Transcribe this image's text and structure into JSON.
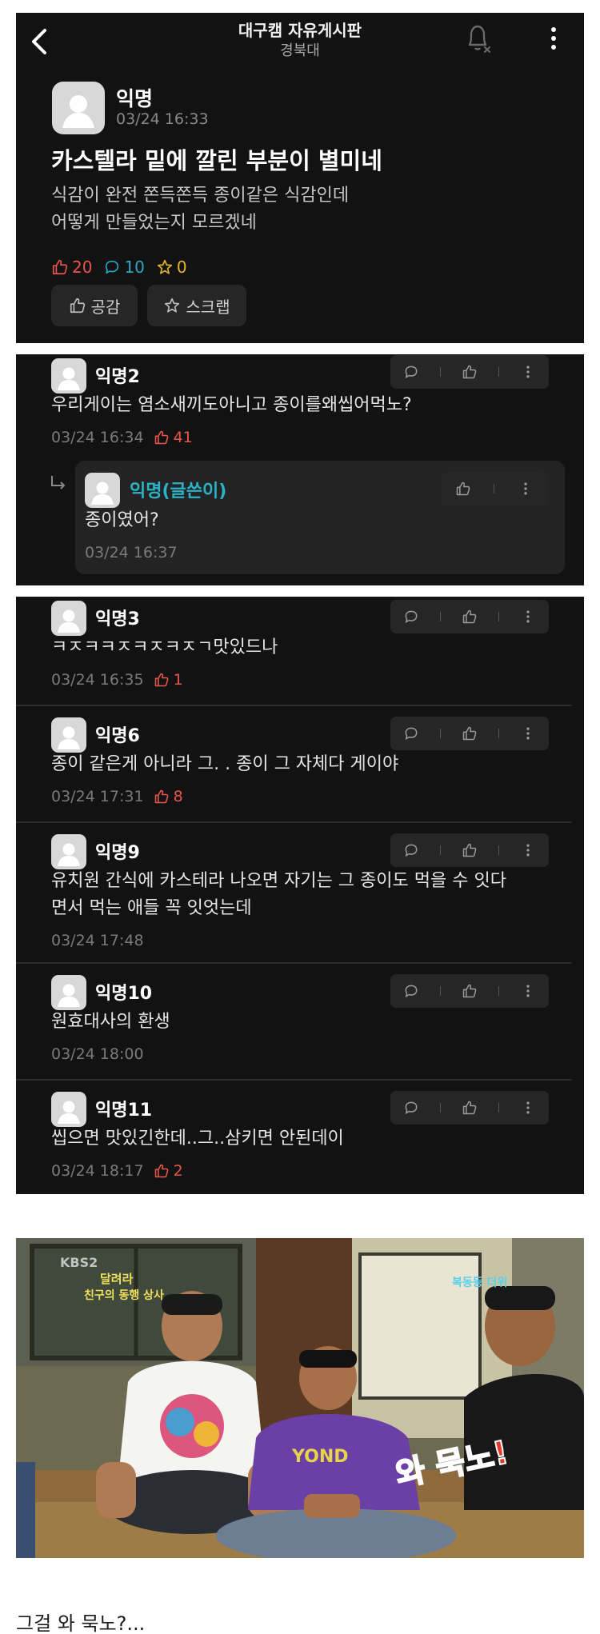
{
  "header": {
    "title": "대구캠 자유게시판",
    "subtitle": "경북대"
  },
  "post": {
    "author": "익명",
    "time": "03/24 16:33",
    "title": "카스텔라 밑에 깔린 부분이 별미네",
    "body": [
      "식감이 완전 쫀득쫀득 종이같은 식감인데",
      "어떻게 만들었는지 모르겠네"
    ],
    "likes": "20",
    "comments": "10",
    "scraps": "0",
    "like_button": "공감",
    "scrap_button": "스크랩"
  },
  "comments_a": [
    {
      "author": "익명2",
      "text": "우리게이는 염소새끼도아니고 종이를왜씹어먹노?",
      "time": "03/24 16:34",
      "likes": "41"
    }
  ],
  "reply": {
    "author": "익명(글쓴이)",
    "text": "종이였어?",
    "time": "03/24 16:37"
  },
  "comments_b": [
    {
      "author": "익명3",
      "text": [
        "ㅋㅈㅋㅋㅈㅋㅈㅋㅈㄱ맛있드나"
      ],
      "time": "03/24 16:35",
      "likes": "1"
    },
    {
      "author": "익명6",
      "text": [
        "종이 같은게 아니라 그. .  종이 그 자체다 게이야"
      ],
      "time": "03/24 17:31",
      "likes": "8"
    },
    {
      "author": "익명9",
      "text": [
        "유치원 간식에 카스테라 나오면 자기는 그 종이도 먹을 수 잇다",
        "면서 먹는 애들 꼭 잇엇는데"
      ],
      "time": "03/24 17:48",
      "likes": ""
    },
    {
      "author": "익명10",
      "text": [
        "원효대사의 환생"
      ],
      "time": "03/24 18:00",
      "likes": ""
    },
    {
      "author": "익명11",
      "text": [
        "씹으면 맛있긴한데..그..삼키면 안된데이"
      ],
      "time": "03/24 18:17",
      "likes": "2"
    }
  ],
  "image": {
    "broadcaster": "KBS2",
    "subtitle_lines": [
      "달려라",
      "친구의 동행 상사"
    ],
    "right_caption": "복동동 더위",
    "overlay_text": "와 묵노!"
  },
  "caption": "그걸 와 묵노?...",
  "colors": {
    "panel_bg": "#121212",
    "like_red": "#e8564b",
    "comment_cyan": "#2aa8c8",
    "scrap_yellow": "#e4b52a",
    "writer_teal": "#2ab3c6"
  },
  "icons": [
    "back-arrow-icon",
    "bell-off-icon",
    "more-vertical-icon",
    "thumbs-up-icon",
    "speech-bubble-icon",
    "star-icon",
    "reply-arrow-icon",
    "avatar-silhouette-icon"
  ]
}
